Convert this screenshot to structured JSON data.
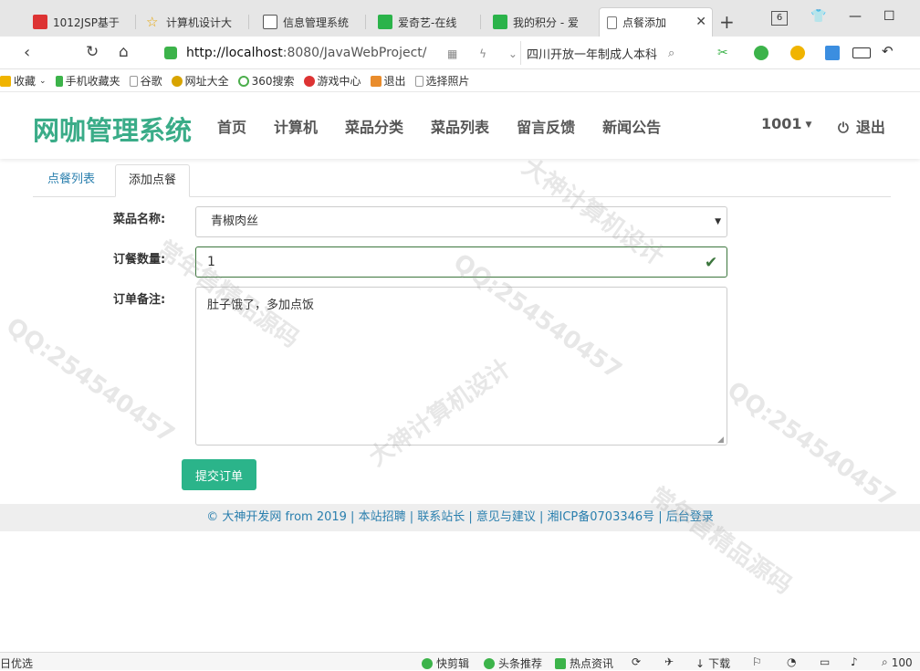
{
  "browser": {
    "tabs": [
      {
        "title": "1012JSP基于",
        "active": false
      },
      {
        "title": "计算机设计大",
        "active": false
      },
      {
        "title": "信息管理系统",
        "active": false
      },
      {
        "title": "爱奇艺-在线",
        "active": false
      },
      {
        "title": "我的积分 - 爱",
        "active": false
      },
      {
        "title": "点餐添加",
        "active": true
      }
    ],
    "tab_count": "6",
    "url_host": "http://localhost",
    "url_rest": ":8080/JavaWebProject/",
    "search_text": "四川开放一年制成人本科",
    "bookmarks": [
      "收藏",
      "手机收藏夹",
      "谷歌",
      "网址大全",
      "360搜索",
      "游戏中心",
      "退出",
      "选择照片"
    ]
  },
  "site": {
    "brand": "网咖管理系统",
    "menu": [
      "首页",
      "计算机",
      "菜品分类",
      "菜品列表",
      "留言反馈",
      "新闻公告"
    ],
    "user": "1001",
    "logout": "退出"
  },
  "tabs": {
    "list": "点餐列表",
    "add": "添加点餐"
  },
  "form": {
    "dish_label": "菜品名称:",
    "dish_value": "青椒肉丝",
    "qty_label": "订餐数量:",
    "qty_value": "1",
    "remark_label": "订单备注:",
    "remark_value": "肚子饿了，多加点饭",
    "submit": "提交订单"
  },
  "footer": "© 大神开发网 from 2019 | 本站招聘 | 联系站长 | 意见与建议 | 湘ICP备0703346号 | 后台登录",
  "watermarks": [
    "QQ:254540457",
    "大神计算机设计",
    "常年售精品源码"
  ],
  "statusbar": {
    "left": "日优选",
    "items": [
      "快剪辑",
      "头条推荐",
      "热点资讯",
      "下载"
    ],
    "zoom": "100"
  },
  "colors": {
    "brand": "#3aac88",
    "primary_button": "#2bb48a",
    "success": "#3c763d",
    "link": "#2a7fae"
  }
}
